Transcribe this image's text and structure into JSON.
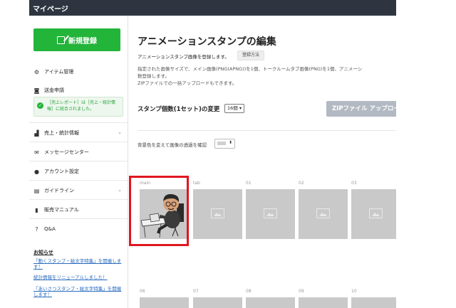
{
  "topbar": {
    "title": "マイページ"
  },
  "sidebar": {
    "new_button": "新規登録",
    "items": [
      {
        "label": "アイテム管理",
        "icon": "gear-icon"
      },
      {
        "label": "送金申請",
        "icon": "coins-icon"
      },
      {
        "label": "売上・統計情報",
        "icon": "bar-chart-icon"
      },
      {
        "label": "メッセージセンター",
        "icon": "envelope-icon"
      },
      {
        "label": "アカウント設定",
        "icon": "person-icon"
      },
      {
        "label": "ガイドライン",
        "icon": "document-icon"
      },
      {
        "label": "販売マニュアル",
        "icon": "book-icon"
      },
      {
        "label": "Q&A",
        "icon": "question-icon"
      }
    ],
    "notice": "［売上レポート］は［売上・統計情報］に統合されました。",
    "news_title": "お知らせ",
    "news": [
      "「動くスタンプ・絵文字特集」を開催します！",
      "統計情報をリニューアルしました！",
      "「あいさつスタンプ・絵文字特集」を開催します！"
    ]
  },
  "main": {
    "title": "アニメーションスタンプの編集",
    "subtitle": "アニメーションスタンプ画像を登録します。",
    "help_button": "登録方法",
    "description": "指定された画像サイズで、メイン画像(PNG(APNG))を1個、トークルームタブ画像(PNG)を1個、アニメーシ\n数登録します。\nZIPファイルでの一括アップロードもできます。",
    "count_label": "スタンプ個数(1セット)の変更",
    "count_value": "16個 ▾",
    "zip_button": "ZIPファイル アップロード",
    "bg_label": "背景色を変えて画像の透過を確認",
    "tiles_row1": [
      "main",
      "tab",
      "01",
      "02",
      "03"
    ],
    "tiles_row2": [
      "06",
      "07",
      "08",
      "09",
      "10"
    ]
  },
  "colors": {
    "accent": "#23b43a",
    "topbar": "#2f3540",
    "highlight": "#e0161f",
    "zip_button": "#b3b9c2"
  }
}
